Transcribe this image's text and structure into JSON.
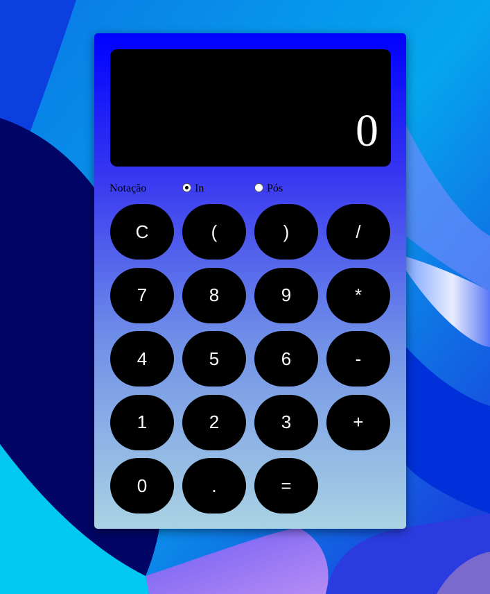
{
  "display": {
    "value": "0"
  },
  "notation": {
    "label": "Notação",
    "options": [
      {
        "label": "In",
        "selected": true
      },
      {
        "label": "Pós",
        "selected": false
      }
    ]
  },
  "keys": [
    [
      "C",
      "(",
      ")",
      "/"
    ],
    [
      "7",
      "8",
      "9",
      "*"
    ],
    [
      "4",
      "5",
      "6",
      "-"
    ],
    [
      "1",
      "2",
      "3",
      "+"
    ],
    [
      "0",
      ".",
      "="
    ]
  ],
  "colors": {
    "panel_top": "#0000ff",
    "panel_bottom": "#a9d3e3",
    "display_bg": "#000000",
    "key_bg": "#000000",
    "key_text": "#ffffff"
  }
}
